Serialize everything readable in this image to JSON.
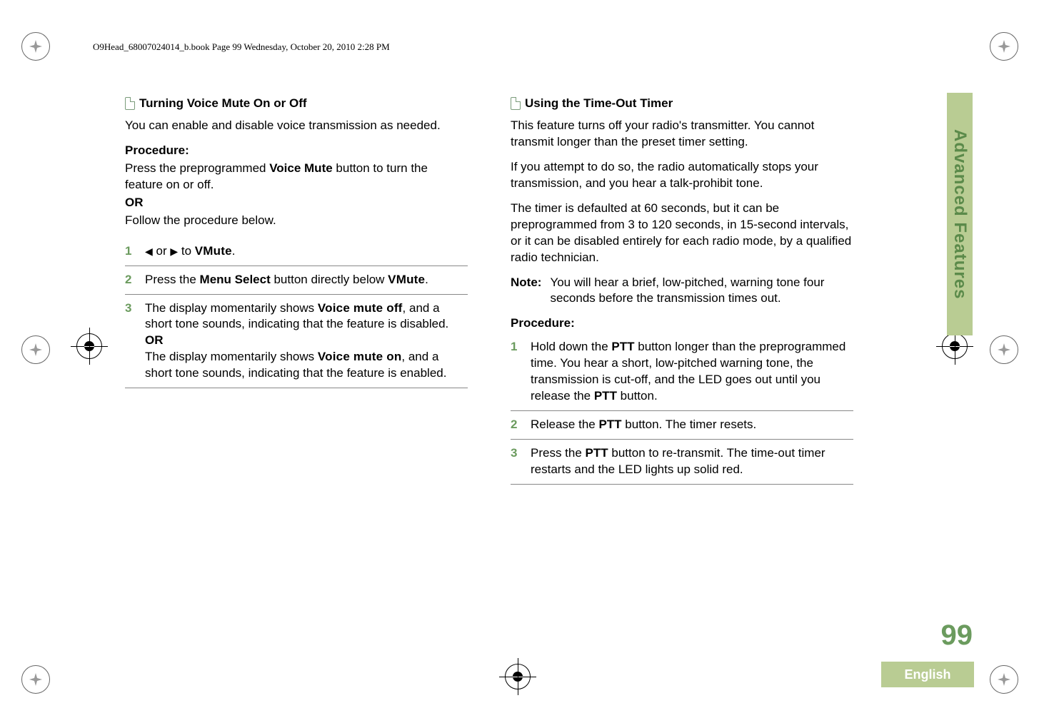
{
  "header": "O9Head_68007024014_b.book  Page 99  Wednesday, October 20, 2010  2:28 PM",
  "sideTab": "Advanced Features",
  "pageNumber": "99",
  "language": "English",
  "left": {
    "heading": "Turning Voice Mute On or Off",
    "intro": "You can enable and disable voice transmission as needed.",
    "procLabel": "Procedure:",
    "preSteps1a": "Press the preprogrammed ",
    "preSteps1b": "Voice Mute",
    "preSteps1c": " button to turn the feature on or off.",
    "or": "OR",
    "preSteps2": "Follow the procedure below.",
    "steps": [
      {
        "num": "1",
        "a": "",
        "arrowL": "◀",
        "mid": " or ",
        "arrowR": "▶",
        "b": " to ",
        "code": "VMute",
        "c": "."
      },
      {
        "num": "2",
        "a": "Press the ",
        "bold": "Menu Select",
        "b": " button directly below ",
        "code": "VMute",
        "c": "."
      },
      {
        "num": "3",
        "a": "The display momentarily shows ",
        "code1": "Voice mute off",
        "b": ", and a short tone sounds, indicating that the feature is disabled.",
        "or": "OR",
        "c": "The display momentarily shows ",
        "code2": "Voice mute on",
        "d": ", and a short tone sounds, indicating that the feature is enabled."
      }
    ]
  },
  "right": {
    "heading": "Using the Time-Out Timer",
    "p1": "This feature turns off your radio's transmitter. You cannot transmit longer than the preset timer setting.",
    "p2": "If you attempt to do so, the radio automatically stops your transmission, and you hear a talk-prohibit tone.",
    "p3": "The timer is defaulted at 60 seconds, but it can be preprogrammed from 3 to 120 seconds, in 15-second intervals, or it can be disabled entirely for each radio mode, by a qualified radio technician.",
    "noteKey": "Note:",
    "noteVal": "You will hear a brief, low-pitched, warning tone four seconds before the transmission times out.",
    "procLabel": "Procedure:",
    "steps": [
      {
        "num": "1",
        "a": "Hold down the ",
        "b1": "PTT",
        "b": " button longer than the preprogrammed time. You hear a short, low-pitched warning tone, the transmission is cut-off, and the LED goes out until you release the ",
        "b2": "PTT",
        "c": " button."
      },
      {
        "num": "2",
        "a": "Release the ",
        "b1": "PTT",
        "b": " button. The timer resets."
      },
      {
        "num": "3",
        "a": "Press the ",
        "b1": "PTT",
        "b": " button to re-transmit. The time-out timer restarts and the LED lights up solid red."
      }
    ]
  }
}
